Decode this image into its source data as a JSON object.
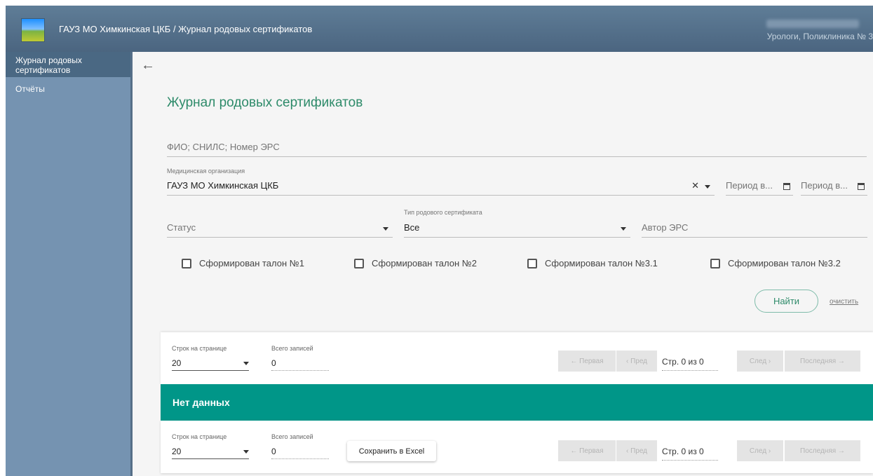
{
  "header": {
    "title": "ГАУЗ МО Химкинская ЦКБ / Журнал родовых сертификатов",
    "user_role": "Урологи, Поликлиника № 3"
  },
  "sidebar": {
    "items": [
      {
        "label": "Журнал родовых сертификатов"
      },
      {
        "label": "Отчёты"
      }
    ]
  },
  "main": {
    "title": "Журнал родовых сертификатов",
    "search_placeholder": "ФИО; СНИЛС; Номер ЭРС",
    "org": {
      "label": "Медицинская организация",
      "value": "ГАУЗ МО Химкинская ЦКБ"
    },
    "period_from": "Период в...",
    "period_to": "Период в...",
    "status_placeholder": "Статус",
    "cert_type": {
      "label": "Тип родового сертификата",
      "value": "Все"
    },
    "author_placeholder": "Автор ЭРС",
    "checkboxes": [
      {
        "label": "Сформирован талон №1",
        "checked": false
      },
      {
        "label": "Сформирован талон №2",
        "checked": false
      },
      {
        "label": "Сформирован талон №3.1",
        "checked": false
      },
      {
        "label": "Сформирован талон №3.2",
        "checked": false
      }
    ],
    "find_button": "Найти",
    "clear_link": "очистить"
  },
  "pager": {
    "rows_label": "Строк на странице",
    "rows_value": "20",
    "total_label": "Всего записей",
    "total_value": "0",
    "first": "← Первая",
    "prev": "‹ Пред",
    "page_info": "Стр. 0 из 0",
    "next": "След ›",
    "last": "Последняя →"
  },
  "no_data": "Нет данных",
  "excel_button": "Сохранить в Excel",
  "colors": {
    "accent": "#2e8b6a",
    "teal_bar": "#009688",
    "sidebar": "#7593b1",
    "topbar": "#56718c"
  }
}
